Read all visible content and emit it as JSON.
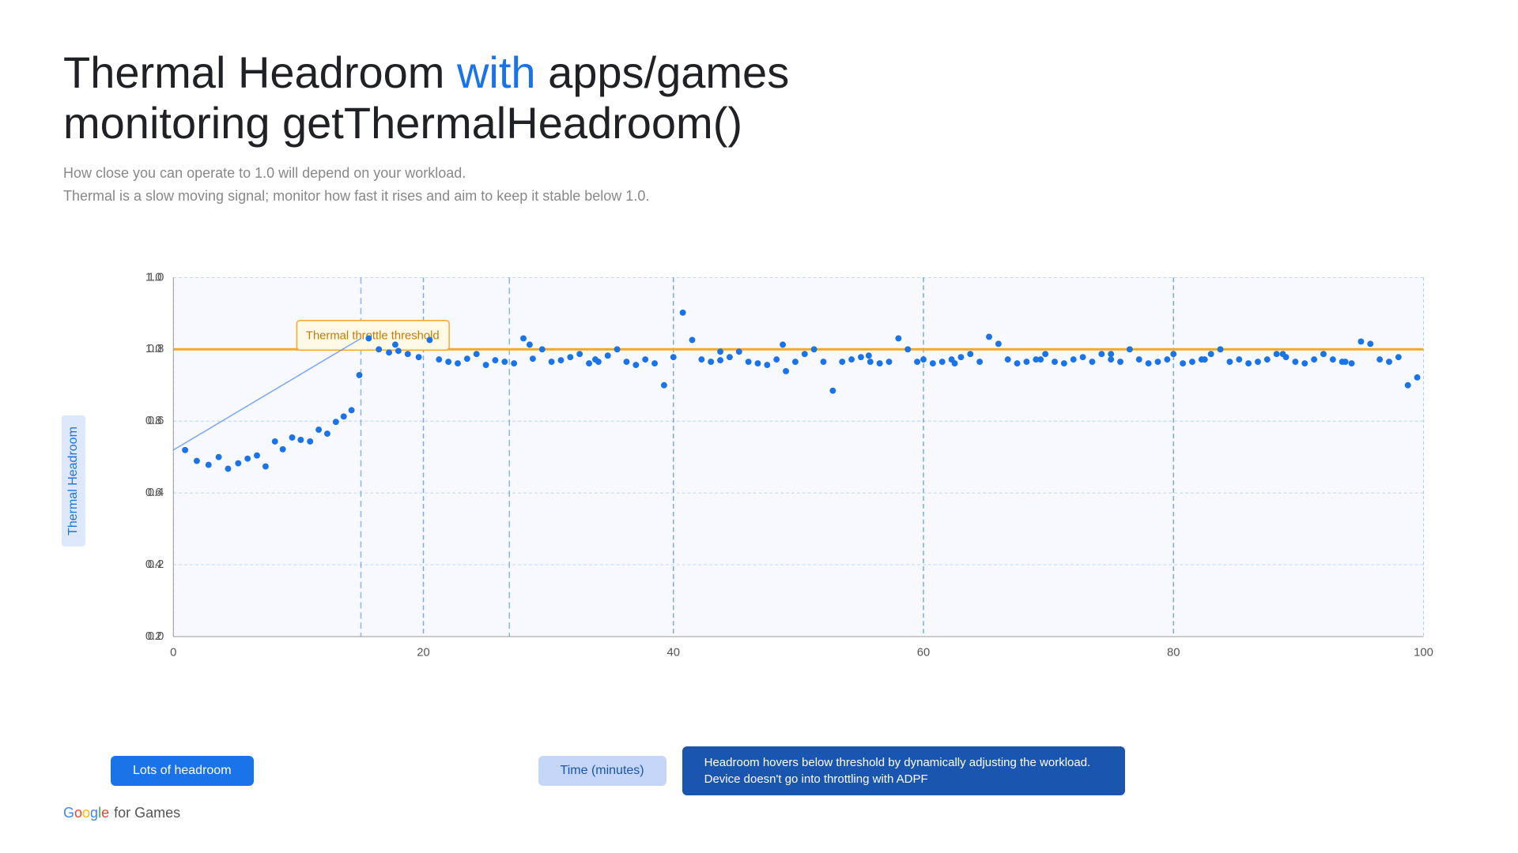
{
  "title": {
    "part1": "Thermal Headroom ",
    "highlight": "with",
    "part2": " apps/games",
    "line2": "monitoring getThermalHeadroom()"
  },
  "subtitle": {
    "line1": "How close you can operate to 1.0 will depend on your workload.",
    "line2": "Thermal is a slow moving signal; monitor how fast it rises and aim to keep it stable below 1.0."
  },
  "chart": {
    "y_axis_label": "Thermal Headroom",
    "x_axis_label": "Time (minutes)",
    "threshold_label": "Thermal throttle threshold",
    "y_ticks": [
      "0.0",
      "0.2",
      "0.4",
      "0.6",
      "0.8",
      "1.0"
    ],
    "x_ticks": [
      "0",
      "20",
      "40",
      "60",
      "80",
      "100"
    ]
  },
  "annotations": {
    "lots_of_headroom": "Lots of headroom",
    "time_minutes": "Time (minutes)",
    "headroom_desc": "Headroom hovers below threshold by dynamically adjusting the workload. Device doesn't go into throttling with ADPF"
  },
  "footer": {
    "google_text": "Google",
    "for_games": " for Games"
  }
}
